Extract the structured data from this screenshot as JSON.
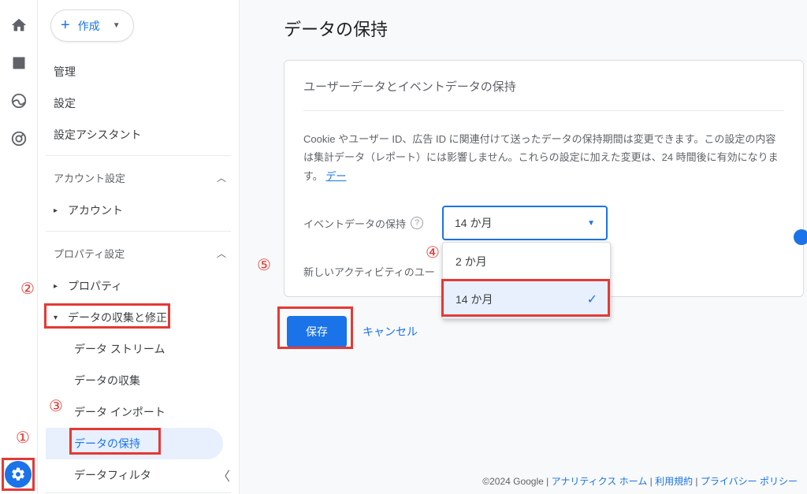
{
  "createButton": {
    "label": "作成"
  },
  "sidebar": {
    "topLinks": [
      "管理",
      "設定",
      "設定アシスタント"
    ],
    "accountSection": {
      "title": "アカウント設定",
      "items": [
        "アカウント"
      ]
    },
    "propertySection": {
      "title": "プロパティ設定",
      "items": [
        "プロパティ"
      ],
      "dataCollection": {
        "label": "データの収集と修正",
        "children": [
          "データ ストリーム",
          "データの収集",
          "データ インポート",
          "データの保持",
          "データフィルタ"
        ]
      }
    }
  },
  "main": {
    "title": "データの保持",
    "cardTitle": "ユーザーデータとイベントデータの保持",
    "description": "Cookie やユーザー ID、広告 ID に関連付けて送ったデータの保持期間は変更できます。この設定の内容は集計データ（レポート）には影響しません。これらの設定に加えた変更は、24 時間後に有効になります。",
    "moreLink": "デー",
    "eventDataLabel": "イベントデータの保持",
    "newActivityLabel": "新しいアクティビティのユー",
    "selectedValue": "14 か月",
    "options": [
      "2 か月",
      "14 か月"
    ],
    "saveLabel": "保存",
    "cancelLabel": "キャンセル"
  },
  "footer": {
    "copyright": "©2024 Google",
    "links": [
      "アナリティクス ホーム",
      "利用規約",
      "プライバシー ポリシー"
    ]
  },
  "annotations": [
    "①",
    "②",
    "③",
    "④",
    "⑤"
  ]
}
